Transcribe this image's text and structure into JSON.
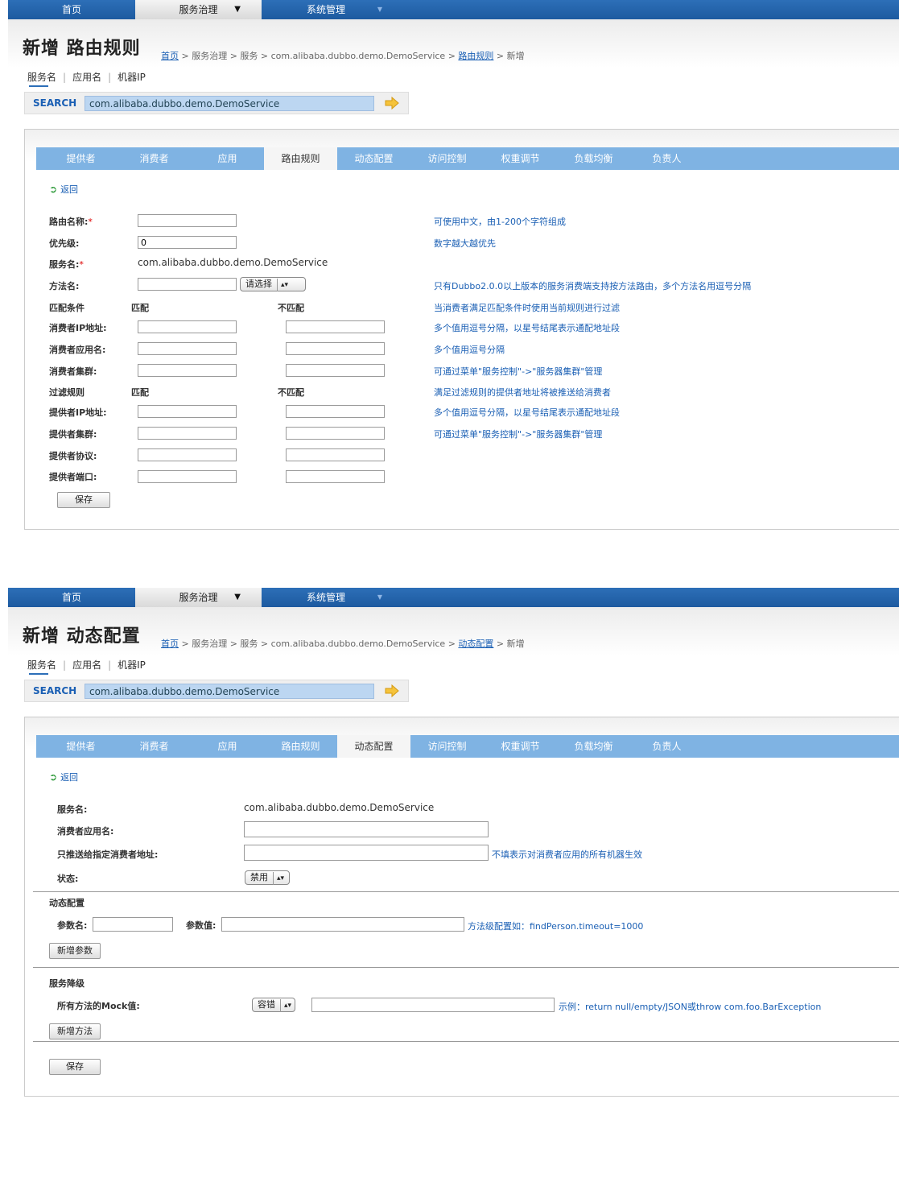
{
  "nav": {
    "home": "首页",
    "service_gov": "服务治理",
    "service_gov_caret": "▼",
    "system_mgmt": "系统管理",
    "system_mgmt_caret": "▼"
  },
  "search": {
    "tabs": [
      "服务名",
      "应用名",
      "机器IP"
    ],
    "label": "SEARCH",
    "value": "com.alibaba.dubbo.demo.DemoService"
  },
  "tabs": [
    "提供者",
    "消费者",
    "应用",
    "路由规则",
    "动态配置",
    "访问控制",
    "权重调节",
    "负载均衡",
    "负责人"
  ],
  "route_page": {
    "title": "新增 路由规则",
    "breadcrumb": {
      "home": "首页",
      "mid": " > 服务治理 > 服务 > com.alibaba.dubbo.demo.DemoService > ",
      "link": "路由规则",
      "tail": " > 新增"
    },
    "active_tab": "路由规则",
    "back": "返回",
    "fields": {
      "route_name": "路由名称:",
      "priority": "优先级:",
      "priority_value": "0",
      "service": "服务名:",
      "service_value": "com.alibaba.dubbo.demo.DemoService",
      "method": "方法名:",
      "method_select": "请选择",
      "match_cond": "匹配条件",
      "match": "匹配",
      "no_match": "不匹配",
      "consumer_ip": "消费者IP地址:",
      "consumer_app": "消费者应用名:",
      "consumer_cluster": "消费者集群:",
      "filter_rule": "过滤规则",
      "filter_match": "匹配",
      "filter_no_match": "不匹配",
      "provider_ip": "提供者IP地址:",
      "provider_cluster": "提供者集群:",
      "provider_protocol": "提供者协议:",
      "provider_port": "提供者端口:",
      "required_mark": "*"
    },
    "hints": {
      "route_name": "可使用中文，由1-200个字符组成",
      "priority": "数字越大越优先",
      "method": "只有Dubbo2.0.0以上版本的服务消费端支持按方法路由，多个方法名用逗号分隔",
      "match_cond": "当消费者满足匹配条件时使用当前规则进行过滤",
      "consumer_ip": "多个值用逗号分隔，以星号结尾表示通配地址段",
      "consumer_app": "多个值用逗号分隔",
      "consumer_cluster": "可通过菜单\"服务控制\"->\"服务器集群\"管理",
      "filter_rule": "满足过滤规则的提供者地址将被推送给消费者",
      "provider_ip": "多个值用逗号分隔，以星号结尾表示通配地址段",
      "provider_cluster": "可通过菜单\"服务控制\"->\"服务器集群\"管理"
    },
    "save": "保存"
  },
  "config_page": {
    "title": "新增 动态配置",
    "breadcrumb": {
      "home": "首页",
      "mid": " > 服务治理 > 服务 > com.alibaba.dubbo.demo.DemoService > ",
      "link": "动态配置",
      "tail": " > 新增"
    },
    "active_tab": "动态配置",
    "back": "返回",
    "fields": {
      "service": "服务名:",
      "service_value": "com.alibaba.dubbo.demo.DemoService",
      "consumer_app": "消费者应用名:",
      "push_addr": "只推送给指定消费者地址:",
      "push_addr_hint": "不填表示对消费者应用的所有机器生效",
      "status": "状态:",
      "status_select": "禁用",
      "dyn_section": "动态配置",
      "param_name": "参数名:",
      "param_value": "参数值:",
      "param_hint": "方法级配置如：findPerson.timeout=1000",
      "add_param": "新增参数",
      "degrade_section": "服务降级",
      "mock_label": "所有方法的Mock值:",
      "mock_select": "容错",
      "mock_hint": "示例：return null/empty/JSON或throw com.foo.BarException",
      "add_method": "新增方法"
    },
    "save": "保存"
  }
}
